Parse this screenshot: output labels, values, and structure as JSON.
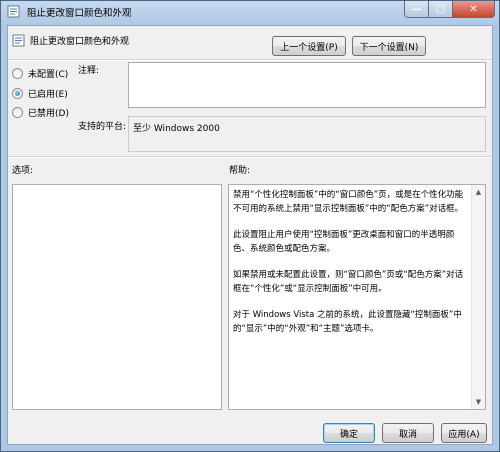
{
  "window": {
    "title": "阻止更改窗口颜色和外观",
    "minimize": "—",
    "maximize": "□",
    "close": "✕"
  },
  "header": {
    "title": "阻止更改窗口颜色和外观",
    "prev_label": "上一个设置(P)",
    "next_label": "下一个设置(N)"
  },
  "state": {
    "options": [
      "未配置(C)",
      "已启用(E)",
      "已禁用(D)"
    ],
    "selected": "已启用(E)"
  },
  "comment": {
    "label": "注释:",
    "value": ""
  },
  "platform": {
    "label": "支持的平台:",
    "value": "至少 Windows 2000"
  },
  "options_section": {
    "label": "选项:"
  },
  "help_section": {
    "label": "帮助:",
    "paragraphs": [
      "禁用“个性化控制面板”中的“窗口颜色”页，或是在个性化功能不可用的系统上禁用“显示控制面板”中的“配色方案”对话框。",
      "此设置阻止用户使用“控制面板”更改桌面和窗口的半透明颜色、系统颜色或配色方案。",
      "如果禁用或未配置此设置，则“窗口颜色”页或“配色方案”对话框在“个性化”或“显示控制面板”中可用。",
      "对于 Windows Vista 之前的系统，此设置隐藏“控制面板”中的“显示”中的“外观”和“主题”选项卡。"
    ]
  },
  "footer": {
    "ok_label": "确定",
    "cancel_label": "取消",
    "apply_label": "应用(A)"
  }
}
